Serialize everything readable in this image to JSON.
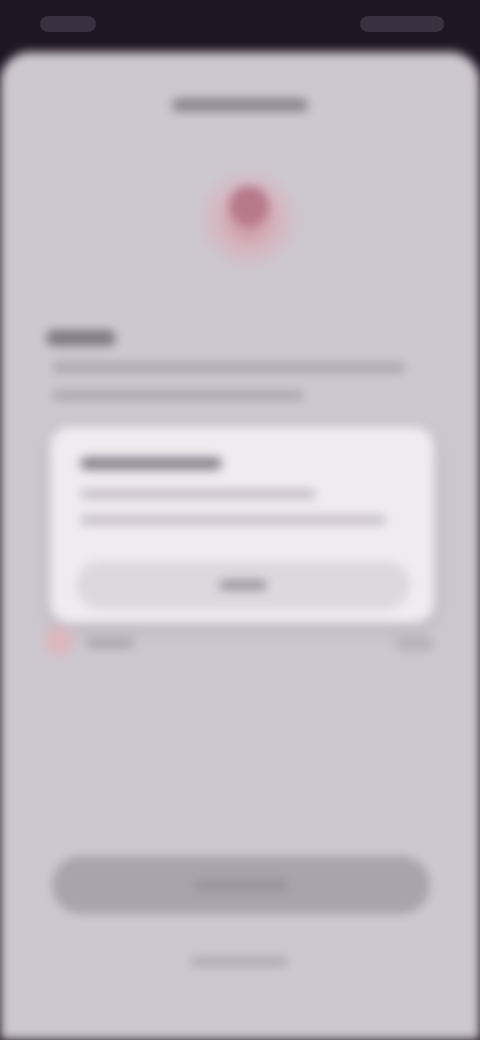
{
  "status_bar": {
    "time": "",
    "indicators": ""
  },
  "sheet": {
    "title": "",
    "logo_icon": "app-logo-icon",
    "heading": "",
    "description_lines": [
      "",
      ""
    ],
    "card": {
      "title": "",
      "body_lines": [
        "",
        ""
      ],
      "button_label": ""
    },
    "option": {
      "icon": "check-icon",
      "label": "",
      "value": ""
    },
    "primary_button_label": "",
    "secondary_link_label": ""
  },
  "colors": {
    "background": "#cdc8cf",
    "accent": "#b7788b",
    "card": "#efecf0",
    "status_bar": "#1f1623"
  }
}
